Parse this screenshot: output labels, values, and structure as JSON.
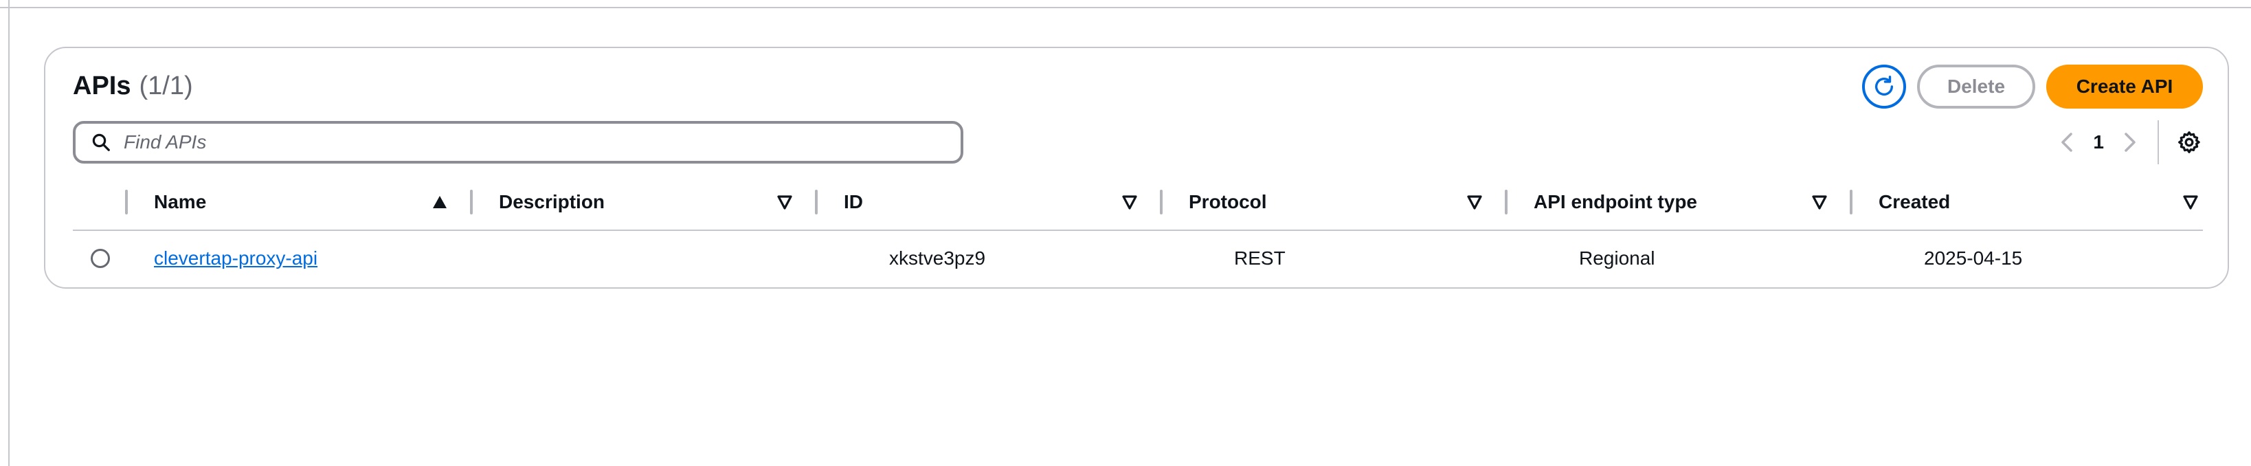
{
  "header": {
    "title": "APIs",
    "count": "(1/1)"
  },
  "actions": {
    "refresh_icon": "refresh-icon",
    "delete_label": "Delete",
    "create_label": "Create API",
    "accent_color": "#ff9900",
    "primary_blue": "#006ce0"
  },
  "search": {
    "placeholder": "Find APIs",
    "value": ""
  },
  "pagination": {
    "current_page": "1",
    "prev_icon": "chevron-left-icon",
    "next_icon": "chevron-right-icon",
    "settings_icon": "gear-icon"
  },
  "table": {
    "columns": [
      {
        "label": "Name",
        "sort": "ascending"
      },
      {
        "label": "Description",
        "sort": "none"
      },
      {
        "label": "ID",
        "sort": "none"
      },
      {
        "label": "Protocol",
        "sort": "none"
      },
      {
        "label": "API endpoint type",
        "sort": "none"
      },
      {
        "label": "Created",
        "sort": "none"
      }
    ],
    "rows": [
      {
        "selected": false,
        "name": "clevertap-proxy-api",
        "description": "",
        "id": "xkstve3pz9",
        "protocol": "REST",
        "endpoint_type": "Regional",
        "created": "2025-04-15"
      }
    ]
  }
}
